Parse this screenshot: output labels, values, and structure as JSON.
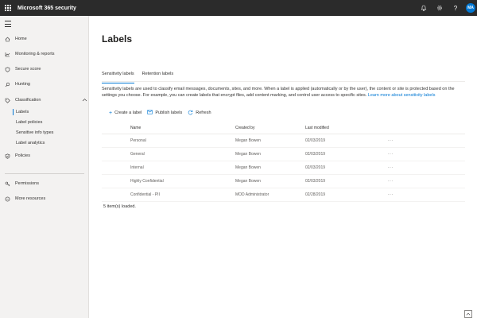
{
  "app": {
    "title": "Microsoft 365 security"
  },
  "header": {
    "avatar_initials": "MA",
    "icons": [
      "bell-icon",
      "gear-icon",
      "help-icon"
    ]
  },
  "sidebar": {
    "items": [
      {
        "label": "Home",
        "icon": "home-icon"
      },
      {
        "label": "Monitoring & reports",
        "icon": "chart-icon"
      },
      {
        "label": "Secure score",
        "icon": "shield-icon"
      },
      {
        "label": "Hunting",
        "icon": "search-icon"
      },
      {
        "label": "Classification",
        "icon": "tag-icon"
      },
      {
        "label": "Policies",
        "icon": "policy-icon"
      },
      {
        "label": "Permissions",
        "icon": "key-icon"
      },
      {
        "label": "More resources",
        "icon": "more-icon"
      }
    ],
    "sub_items": [
      {
        "label": "Labels",
        "active": true
      },
      {
        "label": "Label policies"
      },
      {
        "label": "Sensitive info types"
      },
      {
        "label": "Label analytics"
      }
    ]
  },
  "page": {
    "title": "Labels",
    "tabs": [
      {
        "label": "Sensitivity labels",
        "active": true
      },
      {
        "label": "Retention labels"
      }
    ],
    "description": "Sensitivity labels are used to classify email messages, documents, sites, and more. When a label is applied (automatically or by the user), the content or site is protected based on the settings you choose. For example, you can create labels that encrypt files, add content marking, and control user access to specific sites. ",
    "learn_more": "Learn more about sensitivity labels",
    "commands": [
      {
        "label": "Create a label"
      },
      {
        "label": "Publish labels"
      },
      {
        "label": "Refresh"
      }
    ]
  },
  "table": {
    "columns": [
      "Name",
      "Created by",
      "Last modified"
    ],
    "rows": [
      {
        "name": "Personal",
        "created_by": "Megan Bowen",
        "last_modified": "02/03/2019"
      },
      {
        "name": "General",
        "created_by": "Megan Bowen",
        "last_modified": "02/03/2019"
      },
      {
        "name": "Internal",
        "created_by": "Megan Bowen",
        "last_modified": "02/03/2019"
      },
      {
        "name": "Highly Confidential",
        "created_by": "Megan Bowen",
        "last_modified": "02/03/2019"
      },
      {
        "name": "Confidential - PII",
        "created_by": "MOD Administrator",
        "last_modified": "02/28/2019"
      }
    ],
    "more_glyph": "···",
    "count_text": "5 item(s) loaded."
  },
  "colors": {
    "accent": "#0078d4",
    "topbar": "#2b2b2b",
    "sidebar": "#f3f2f1"
  }
}
